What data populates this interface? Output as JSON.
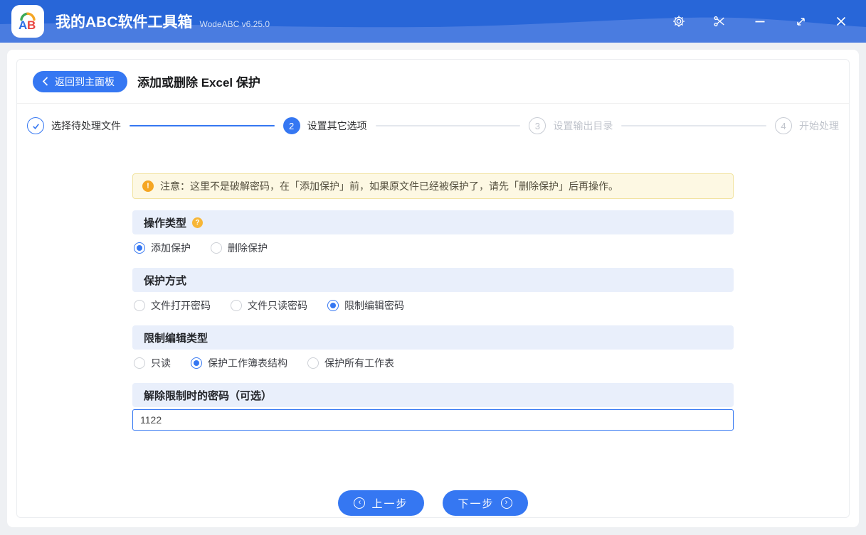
{
  "titlebar": {
    "app_title": "我的ABC软件工具箱",
    "app_version": "WodeABC v6.25.0"
  },
  "header": {
    "back_label": "返回到主面板",
    "page_title": "添加或删除 Excel 保护"
  },
  "steps": [
    {
      "label": "选择待处理文件",
      "number": "",
      "state": "done"
    },
    {
      "label": "设置其它选项",
      "number": "2",
      "state": "active"
    },
    {
      "label": "设置输出目录",
      "number": "3",
      "state": "pending"
    },
    {
      "label": "开始处理",
      "number": "4",
      "state": "pending"
    }
  ],
  "notice": {
    "text": "注意：这里不是破解密码，在「添加保护」前，如果原文件已经被保护了，请先「删除保护」后再操作。"
  },
  "sections": [
    {
      "title": "操作类型",
      "options": [
        {
          "label": "添加保护",
          "state": "on"
        },
        {
          "label": "删除保护",
          "state": "off"
        }
      ]
    },
    {
      "title": "保护方式",
      "options": [
        {
          "label": "文件打开密码",
          "state": "off"
        },
        {
          "label": "文件只读密码",
          "state": "off"
        },
        {
          "label": "限制编辑密码",
          "state": "on"
        }
      ]
    },
    {
      "title": "限制编辑类型",
      "options": [
        {
          "label": "只读",
          "state": "off"
        },
        {
          "label": "保护工作簿表结构",
          "state": "on"
        },
        {
          "label": "保护所有工作表",
          "state": "off"
        }
      ]
    }
  ],
  "password": {
    "title": "解除限制时的密码（可选）",
    "value": "1122"
  },
  "footer": {
    "prev_label": "上一步",
    "next_label": "下一步"
  },
  "colors": {
    "accent": "#3577f2",
    "titlebar-top": "#2866d8",
    "titlebar-wave": "#4a7ce0",
    "page-bg": "#eef0f3",
    "section-bar-bg": "#e9effb",
    "notice-bg": "#fdf8e3",
    "notice-border": "#f2e3a1",
    "notice-icon": "#f5a623",
    "help-icon": "#f7b637",
    "step-gray": "#c0c4cc"
  }
}
